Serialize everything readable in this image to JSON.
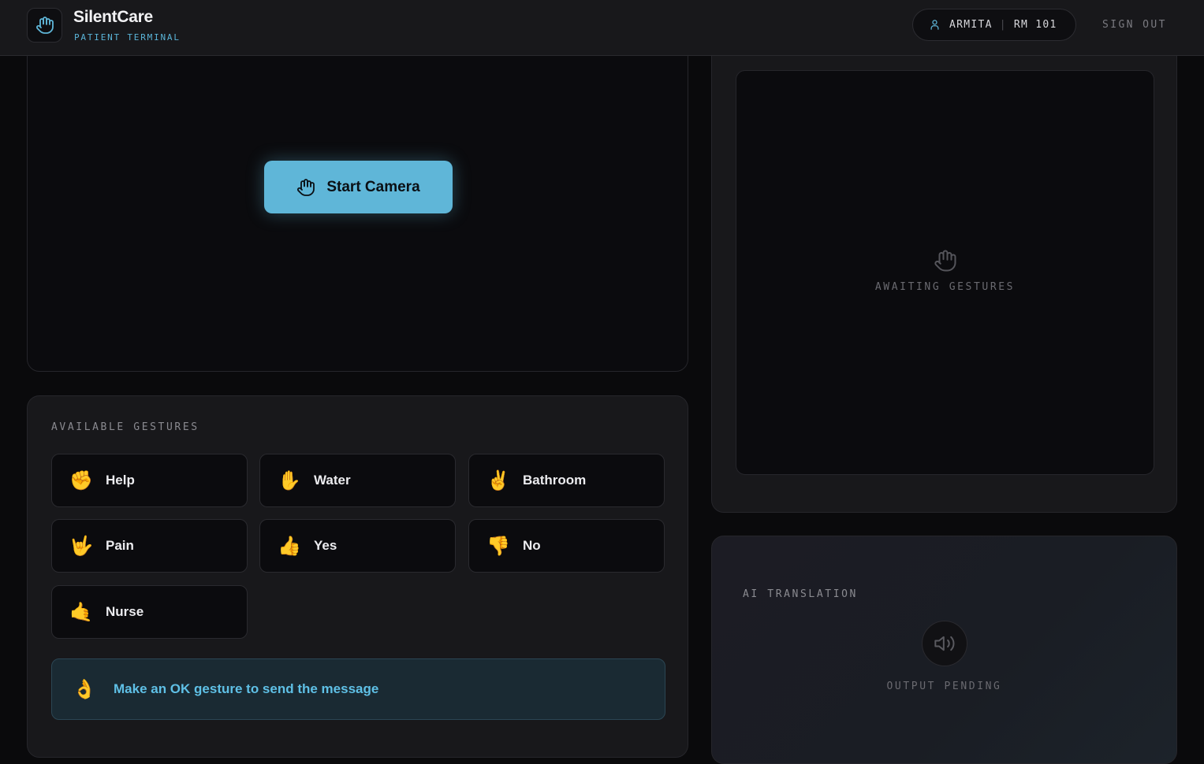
{
  "header": {
    "app_name": "SilentCare",
    "app_subtitle": "PATIENT TERMINAL",
    "user_name": "ARMITA",
    "room": "RM 101",
    "sign_out": "SIGN OUT"
  },
  "camera": {
    "start_label": "Start Camera"
  },
  "gestures": {
    "title": "AVAILABLE GESTURES",
    "items": [
      {
        "emoji": "✊",
        "label": "Help"
      },
      {
        "emoji": "✋",
        "label": "Water"
      },
      {
        "emoji": "✌️",
        "label": "Bathroom"
      },
      {
        "emoji": "🤟",
        "label": "Pain"
      },
      {
        "emoji": "👍",
        "label": "Yes"
      },
      {
        "emoji": "👎",
        "label": "No"
      },
      {
        "emoji": "🤙",
        "label": "Nurse"
      }
    ],
    "hint_emoji": "👌",
    "hint_text": "Make an OK gesture to send the message"
  },
  "feed": {
    "status": "AWAITING GESTURES"
  },
  "ai": {
    "title": "AI TRANSLATION",
    "status": "OUTPUT PENDING"
  },
  "colors": {
    "accent": "#5fb6d8",
    "background": "#0a0a0c",
    "panel": "#18181b"
  }
}
